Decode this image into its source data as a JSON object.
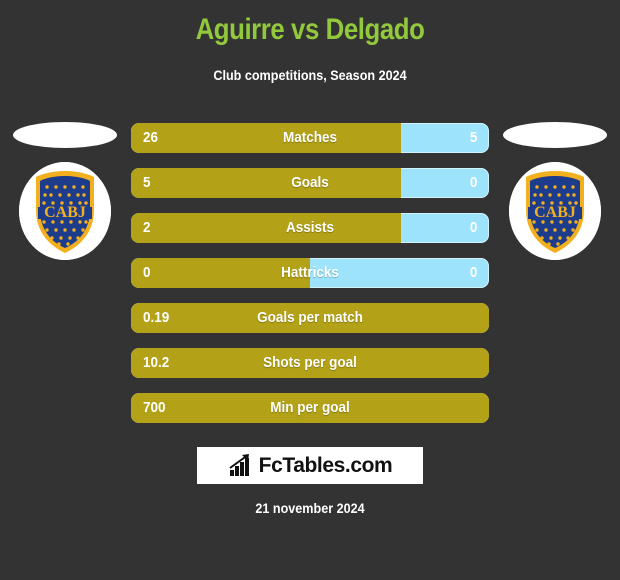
{
  "header": {
    "title": "Aguirre vs Delgado",
    "subtitle": "Club competitions, Season 2024",
    "title_color": "#92c83c",
    "subtitle_color": "#ffffff"
  },
  "theme": {
    "background": "#333333",
    "bar_left_color": "#b3a217",
    "bar_right_color": "#9ce3fb",
    "text_color": "#ffffff"
  },
  "crests": {
    "left": {
      "name": "CABJ",
      "alt": "Boca Juniors crest",
      "shield_color": "#1d3c8c",
      "border_color": "#f2b01e",
      "text": "CABJ"
    },
    "right": {
      "name": "CABJ",
      "alt": "Boca Juniors crest",
      "shield_color": "#1d3c8c",
      "border_color": "#f2b01e",
      "text": "CABJ"
    }
  },
  "chart_data": {
    "type": "bar",
    "title": "Aguirre vs Delgado",
    "subtitle": "Club competitions, Season 2024",
    "categories": [
      "Matches",
      "Goals",
      "Assists",
      "Hattricks",
      "Goals per match",
      "Shots per goal",
      "Min per goal"
    ],
    "series": [
      {
        "name": "Aguirre",
        "values": [
          "26",
          "5",
          "2",
          "0",
          "0.19",
          "10.2",
          "700"
        ]
      },
      {
        "name": "Delgado",
        "values": [
          "5",
          "0",
          "0",
          "0",
          null,
          null,
          null
        ]
      }
    ],
    "legend": "none",
    "grid": false
  },
  "stats": [
    {
      "label": "Matches",
      "left": "26",
      "right": "5",
      "fill_pct": 75.4,
      "has_right": true
    },
    {
      "label": "Goals",
      "left": "5",
      "right": "0",
      "fill_pct": 75.4,
      "has_right": true
    },
    {
      "label": "Assists",
      "left": "2",
      "right": "0",
      "fill_pct": 75.4,
      "has_right": true
    },
    {
      "label": "Hattricks",
      "left": "0",
      "right": "0",
      "fill_pct": 50.0,
      "has_right": true
    },
    {
      "label": "Goals per match",
      "left": "0.19",
      "right": "",
      "fill_pct": 100,
      "has_right": false
    },
    {
      "label": "Shots per goal",
      "left": "10.2",
      "right": "",
      "fill_pct": 100,
      "has_right": false
    },
    {
      "label": "Min per goal",
      "left": "700",
      "right": "",
      "fill_pct": 100,
      "has_right": false
    }
  ],
  "footer": {
    "logo_text": "FcTables.com",
    "logo_icon": "bar-chart-arrow-icon",
    "date": "21 november 2024"
  }
}
